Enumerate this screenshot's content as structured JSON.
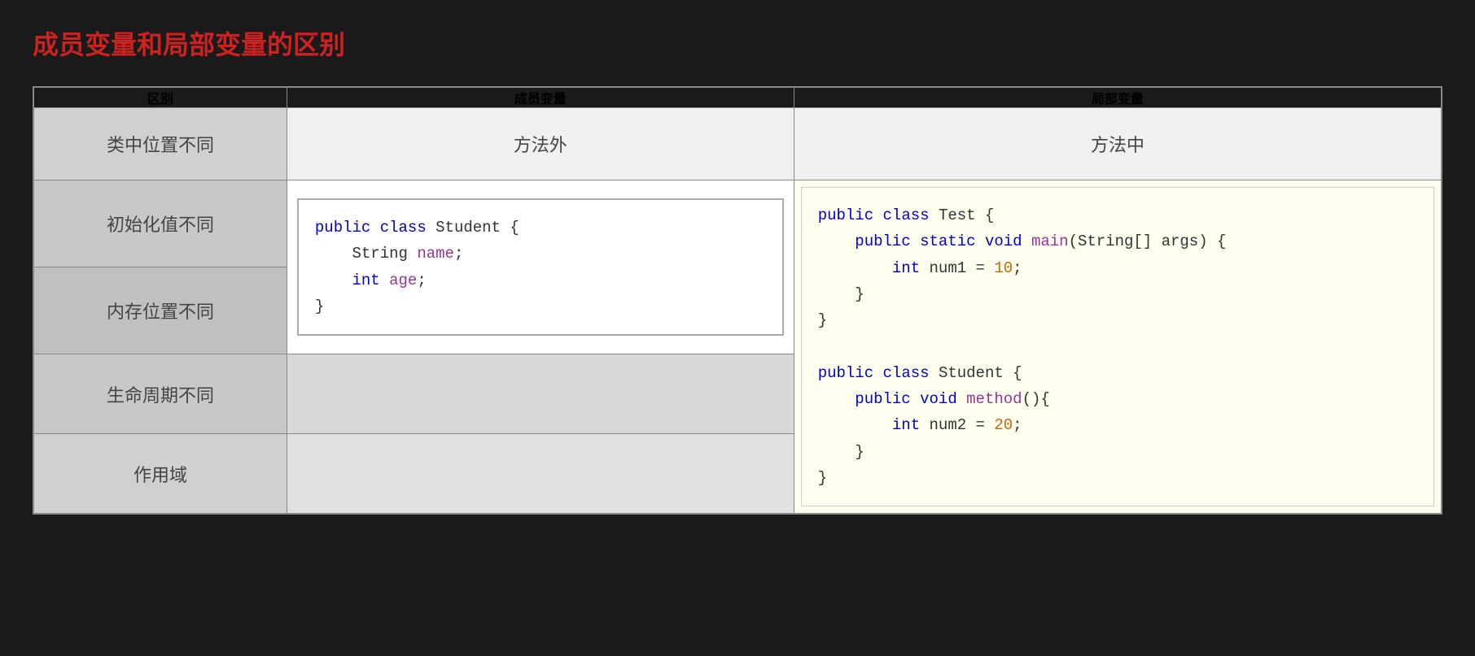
{
  "title": "成员变量和局部变量的区别",
  "header": {
    "col1": "区别",
    "col2": "成员变量",
    "col3": "局部变量"
  },
  "rows": [
    {
      "label": "类中位置不同",
      "member": "方法外",
      "local": "方法中"
    },
    {
      "label": "初始化值不同",
      "member_code": true,
      "local_code": true
    },
    {
      "label": "内存位置不同",
      "member_empty": true,
      "local_empty": true
    },
    {
      "label": "生命周期不同",
      "member_empty": true,
      "local_empty": true
    },
    {
      "label": "作用域",
      "member_empty": true,
      "local_empty": true
    }
  ],
  "member_code": {
    "line1": "public class Student {",
    "line2": "    String name;",
    "line3": "    int age;",
    "line4": "}"
  },
  "local_code": {
    "block1_line1": "public class Test {",
    "block1_line2": "    public static void main(String[] args) {",
    "block1_line3": "        int num1 = 10;",
    "block1_line4": "    }",
    "block1_line5": "}",
    "block2_line1": "public class Student {",
    "block2_line2": "    public void method(){",
    "block2_line3": "        int num2 = 20;",
    "block2_line4": "    }",
    "block2_line5": "}"
  }
}
